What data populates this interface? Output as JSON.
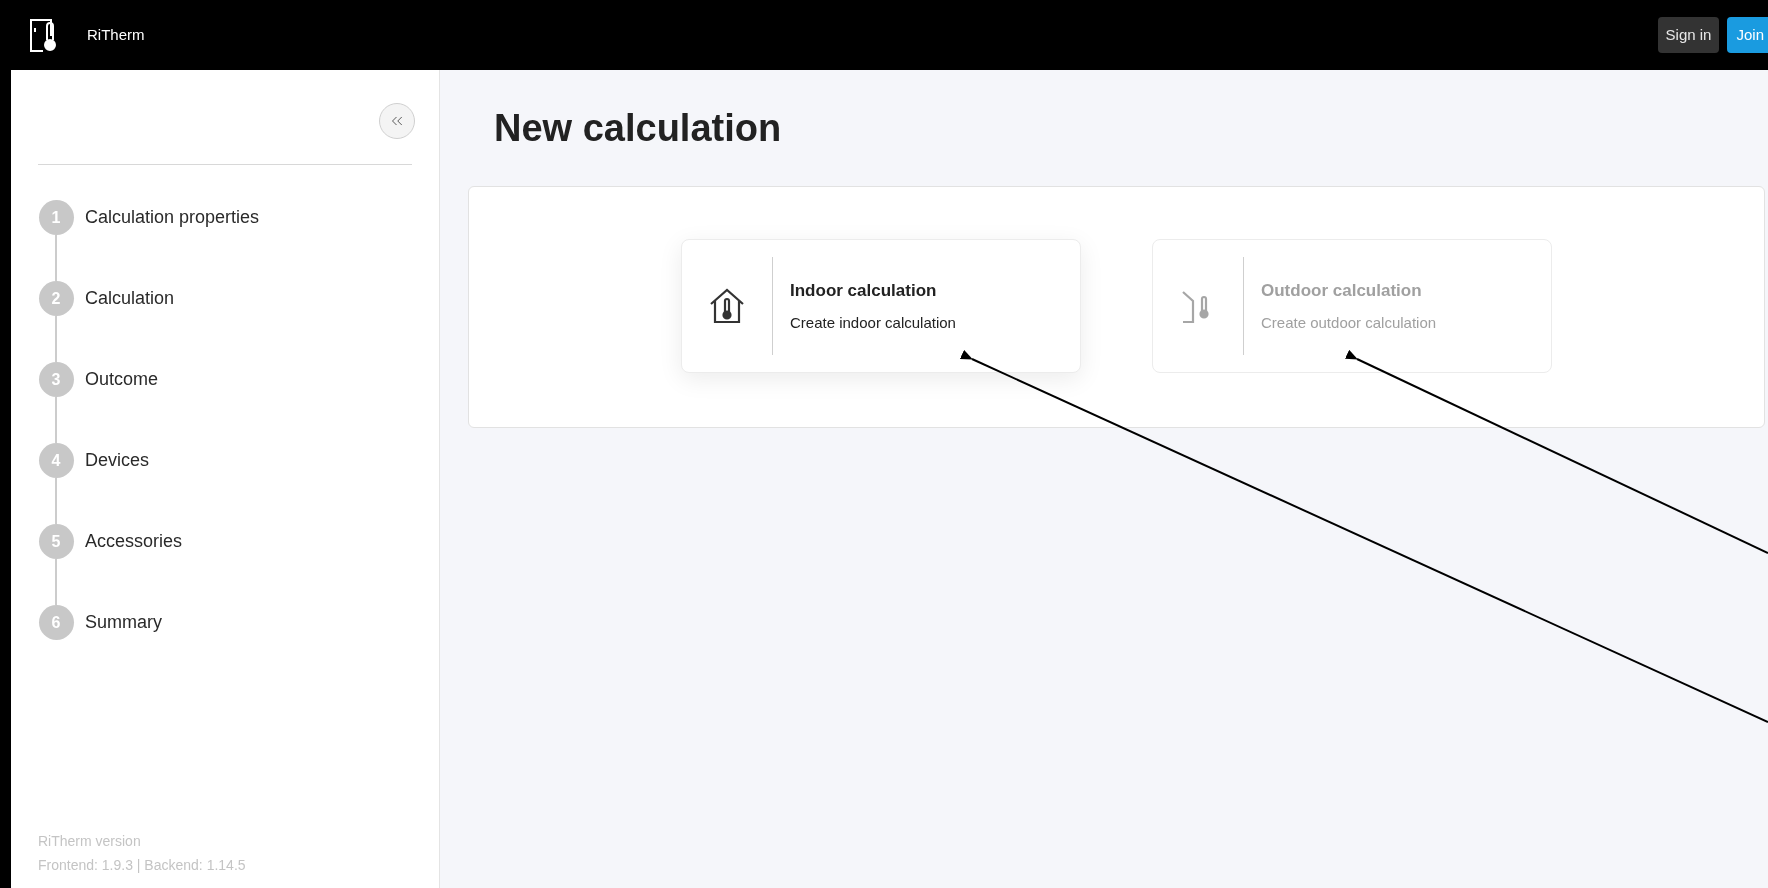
{
  "header": {
    "app_name": "RiTherm",
    "buttons": [
      {
        "label": "Sign in",
        "kind": "secondary"
      },
      {
        "label": "Join",
        "kind": "primary"
      }
    ]
  },
  "sidebar": {
    "steps": [
      {
        "number": "1",
        "label": "Calculation properties"
      },
      {
        "number": "2",
        "label": "Calculation"
      },
      {
        "number": "3",
        "label": "Outcome"
      },
      {
        "number": "4",
        "label": "Devices"
      },
      {
        "number": "5",
        "label": "Accessories"
      },
      {
        "number": "6",
        "label": "Summary"
      }
    ],
    "version_title": "RiTherm version",
    "version_info": "Frontend: 1.9.3 | Backend: 1.14.5"
  },
  "page": {
    "title": "New calculation",
    "options": [
      {
        "kind": "indoor",
        "title": "Indoor calculation",
        "subtitle": "Create indoor calculation",
        "disabled": false
      },
      {
        "kind": "outdoor",
        "title": "Outdoor calculation",
        "subtitle": "Create outdoor calculation",
        "disabled": true
      }
    ]
  }
}
